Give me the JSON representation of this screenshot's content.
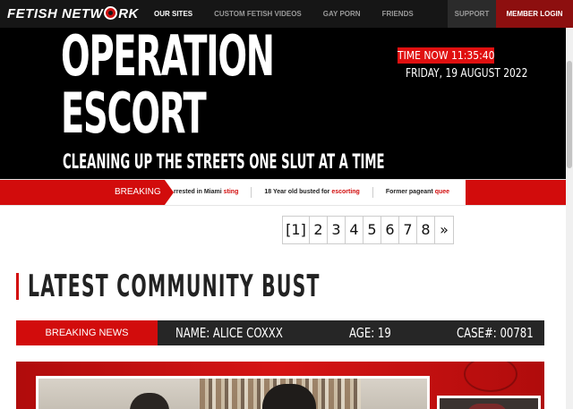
{
  "nav": {
    "logo": {
      "part1": "FETISH",
      "part2": "NETW",
      "part3": "RK"
    },
    "items": [
      {
        "label": "OUR SITES",
        "active": true
      },
      {
        "label": "CUSTOM FETISH VIDEOS",
        "active": false
      },
      {
        "label": "GAY PORN",
        "active": false
      },
      {
        "label": "FRIENDS",
        "active": false
      }
    ],
    "support_label": "SUPPORT",
    "login_label": "MEMBER LOGIN"
  },
  "hero": {
    "title_line1": "OPERATION",
    "title_line2": "ESCORT",
    "tagline": "CLEANING UP THE STREETS ONE SLUT AT A TIME",
    "time_label": "TIME NOW 11:35:40",
    "date_label": "FRIDAY, 19 AUGUST 2022"
  },
  "ticker": {
    "label": "BREAKING",
    "items": [
      {
        "text": "rrested in Miami ",
        "highlight": "sting"
      },
      {
        "text": "18 Year old busted for ",
        "highlight": "escorting"
      },
      {
        "text": "Former pageant ",
        "highlight": "quee"
      }
    ]
  },
  "pagination": {
    "pages": [
      "[1]",
      "2",
      "3",
      "4",
      "5",
      "6",
      "7",
      "8",
      "»"
    ]
  },
  "section": {
    "title": "LATEST COMMUNITY BUST"
  },
  "case": {
    "breaking_label": "BREAKING NEWS",
    "name": "NAME: ALICE COXXX",
    "age": "AGE: 19",
    "case_no": "CASE#: 00781"
  },
  "colors": {
    "accent_red": "#d20c0c",
    "nav_bg": "#161616",
    "hero_bg": "#000000",
    "casebar_bg": "#262626"
  }
}
